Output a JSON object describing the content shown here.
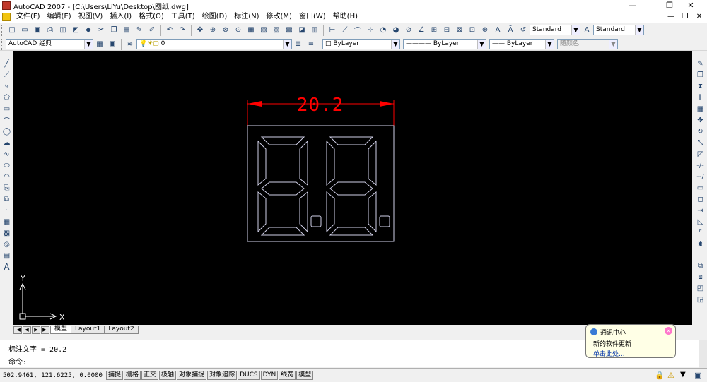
{
  "window": {
    "title": "AutoCAD 2007 - [C:\\Users\\LiYu\\Desktop\\图纸.dwg]",
    "buttons": {
      "minimize": "—",
      "restore": "❐",
      "close": "✕"
    }
  },
  "menu": {
    "items": [
      "文件(F)",
      "编辑(E)",
      "视图(V)",
      "插入(I)",
      "格式(O)",
      "工具(T)",
      "绘图(D)",
      "标注(N)",
      "修改(M)",
      "窗口(W)",
      "帮助(H)"
    ],
    "doc_buttons": {
      "minimize": "—",
      "restore": "❐",
      "close": "✕"
    }
  },
  "toolbar": {
    "text_style": "Standard",
    "dim_style": "Standard",
    "workspace": "AutoCAD 经典",
    "layer": "0",
    "color": "ByLayer",
    "linetype": "ByLayer",
    "lineweight": "ByLayer",
    "plotstyle": "随颜色"
  },
  "drawing": {
    "dimension_text": "20.2",
    "ucs_x_label": "X",
    "ucs_y_label": "Y",
    "colors": {
      "background": "#000000",
      "dimension": "#ff0000",
      "geometry": "#d0d0e8",
      "ucs": "#ffffff"
    }
  },
  "tabs": [
    "模型",
    "Layout1",
    "Layout2"
  ],
  "command": {
    "history": "标注文字 = 20.2",
    "prompt": "命令:"
  },
  "status": {
    "coords": "502.9461, 121.6225, 0.0000",
    "toggles": [
      "捕捉",
      "栅格",
      "正交",
      "极轴",
      "对象捕捉",
      "对象追踪",
      "DUCS",
      "DYN",
      "线宽",
      "模型"
    ]
  },
  "balloon": {
    "title": "通讯中心",
    "line1": "新的软件更新",
    "link": "单击此处..."
  }
}
